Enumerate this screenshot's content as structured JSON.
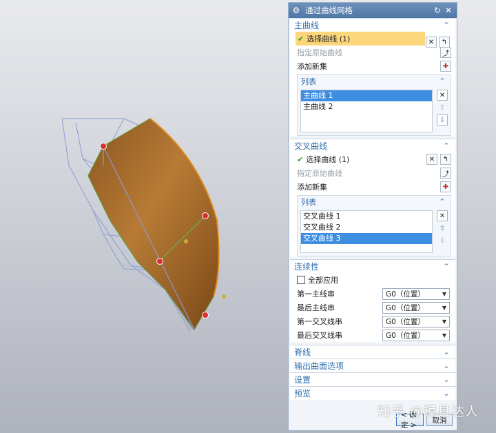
{
  "dialog": {
    "title": "通过曲线网格",
    "title_icon": "gear-icon",
    "reset_icon": "refresh-icon",
    "close_icon": "close-icon"
  },
  "primary": {
    "header": "主曲线",
    "select_label": "选择曲线 (1)",
    "specify_origin": "指定原始曲线",
    "add_new_set": "添加新集",
    "list_header": "列表",
    "items": [
      "主曲线 1",
      "主曲线 2"
    ],
    "selected_index": 0
  },
  "cross": {
    "header": "交叉曲线",
    "select_label": "选择曲线 (1)",
    "specify_origin": "指定原始曲线",
    "add_new_set": "添加新集",
    "list_header": "列表",
    "items": [
      "交叉曲线 1",
      "交叉曲线 2",
      "交叉曲线 3"
    ],
    "selected_index": 2
  },
  "continuity": {
    "header": "连续性",
    "apply_all": "全部应用",
    "apply_all_checked": false,
    "rows": [
      {
        "label": "第一主线串",
        "value": "G0（位置）"
      },
      {
        "label": "最后主线串",
        "value": "G0（位置）"
      },
      {
        "label": "第一交叉线串",
        "value": "G0（位置）"
      },
      {
        "label": "最后交叉线串",
        "value": "G0（位置）"
      }
    ]
  },
  "collapsed_sections": [
    "脊线",
    "输出曲面选项",
    "设置",
    "预览"
  ],
  "footer": {
    "ok": "< 确定 >",
    "cancel": "取消"
  },
  "watermark": "知乎 @模具达人",
  "colors": {
    "title_bar": "#5a80ad",
    "section_header_text": "#2f6eb0",
    "selection_highlight": "#fbd67b",
    "list_selected": "#3d8ee0",
    "surface_fill": "#a86f2c",
    "wire_lines": "#8b9ad6"
  }
}
